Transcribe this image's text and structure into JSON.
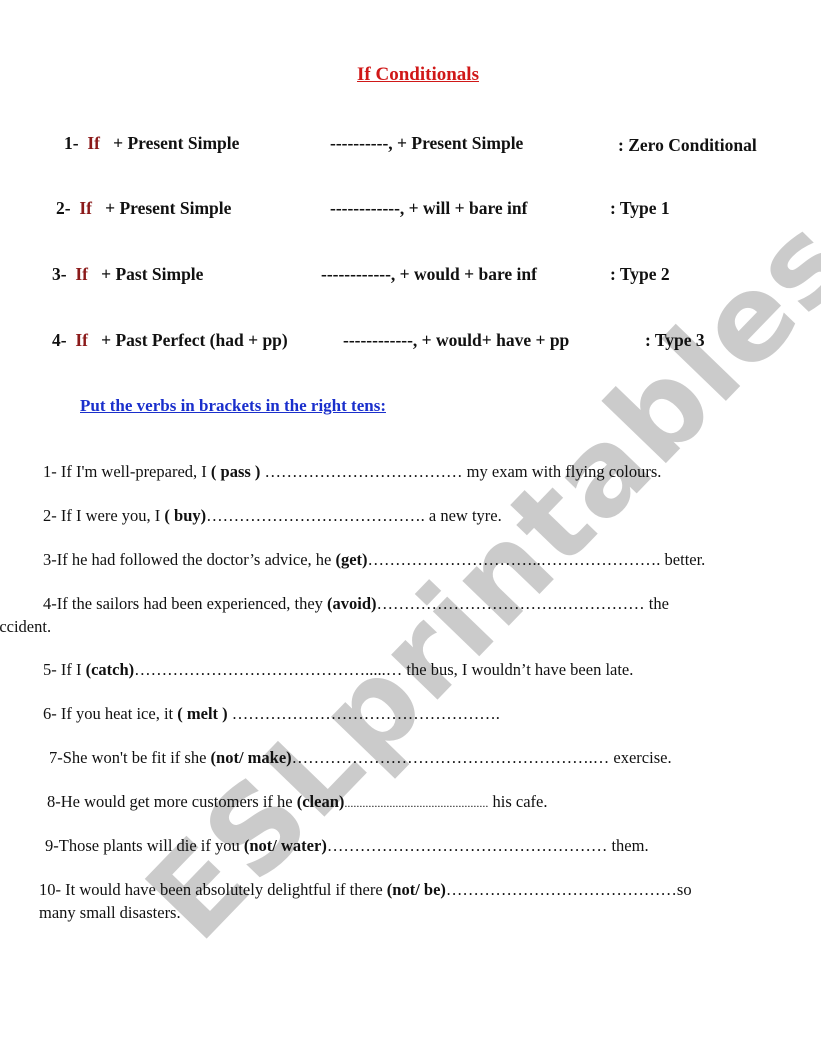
{
  "document": {
    "title": "If Conditionals",
    "rules": [
      {
        "num": "1-",
        "if": "If",
        "clause1": "+ Present Simple",
        "clause2": "----------, + Present Simple",
        "type": ": Zero Conditional"
      },
      {
        "num": "2-",
        "if": "If",
        "clause1": "+ Present Simple",
        "clause2": "------------, + will + bare inf",
        "type": ": Type 1"
      },
      {
        "num": "3-",
        "if": "If",
        "clause1": "+ Past Simple",
        "clause2": "------------, + would + bare inf",
        "type": ": Type 2"
      },
      {
        "num": "4-",
        "if": "If",
        "clause1": "+ Past Perfect (had + pp)",
        "clause2": "------------, + would+ have + pp",
        "type": ": Type 3"
      }
    ],
    "instruction": "Put  the verbs in brackets in the right tens:",
    "exercises": [
      {
        "pre": "1- If I'm well-prepared, I ",
        "verb": "( pass )",
        "gap": " ………………………………",
        "post": " my exam with flying colours.",
        "cont": ""
      },
      {
        "pre": "2- If I were you, I ",
        "verb": "( buy)",
        "gap": "………………………………….",
        "post": " a new tyre.",
        "cont": ""
      },
      {
        "pre": "3-If he had followed the doctor’s advice, he ",
        "verb": "(get)",
        "gap": "…………………………..………………….",
        "post": " better.",
        "cont": ""
      },
      {
        "pre": "4-If the sailors had been experienced, they ",
        "verb": "(avoid)",
        "gap": "…………………………….……………",
        "post": " the",
        "cont": "accident."
      },
      {
        "pre": "5- If I ",
        "verb": "(catch)",
        "gap": "…………………………………….....…",
        "post": " the bus, I wouldn’t have been late.",
        "cont": ""
      },
      {
        "pre": "6- If you heat ice, it ",
        "verb": "( melt )",
        "gap": " ………………………………………….",
        "post": "",
        "cont": ""
      },
      {
        "pre": "7-She won't be fit if she ",
        "verb": "(not/ make)",
        "gap": "……………………………………………….…",
        "post": " exercise.",
        "cont": ""
      },
      {
        "pre": "8-He would get more customers if he ",
        "verb": "(clean)",
        "gap": "................................................",
        "post": " his cafe.",
        "cont": ""
      },
      {
        "pre": "9-Those plants will die if you ",
        "verb": "(not/ water)",
        "gap": "……………………………………………",
        "post": " them.",
        "cont": ""
      },
      {
        "pre": "10- It would have been absolutely delightful if there ",
        "verb": "(not/ be)",
        "gap": "……………………………………",
        "post": "so",
        "cont": "many small disasters."
      }
    ],
    "watermark": "ESLprintables.com"
  }
}
